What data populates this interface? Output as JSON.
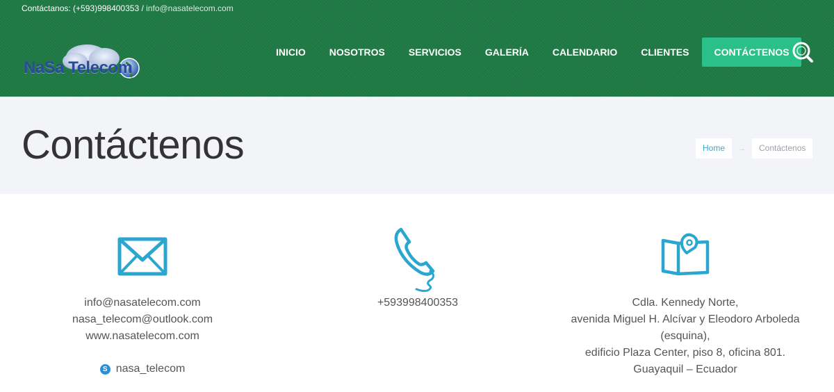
{
  "topbar": {
    "label": "Contáctanos: (+593)998400353 / ",
    "email": "info@nasatelecom.com"
  },
  "logo": {
    "text": "NaSa Telecom"
  },
  "nav": {
    "items": [
      {
        "label": "INICIO"
      },
      {
        "label": "NOSOTROS"
      },
      {
        "label": "SERVICIOS"
      },
      {
        "label": "GALERÍA"
      },
      {
        "label": "CALENDARIO"
      },
      {
        "label": "CLIENTES"
      },
      {
        "label": "CONTÁCTENOS",
        "active": true
      }
    ],
    "search_icon": "search-icon"
  },
  "page": {
    "title": "Contáctenos",
    "breadcrumb": {
      "home": "Home",
      "separator": "→",
      "current": "Contáctenos"
    }
  },
  "contact": {
    "email": {
      "icon": "envelope-icon",
      "lines": [
        "info@nasatelecom.com",
        "nasa_telecom@outlook.com",
        "www.nasatelecom.com"
      ],
      "skype": "nasa_telecom"
    },
    "phone": {
      "icon": "phone-icon",
      "lines": [
        "+593998400353"
      ]
    },
    "address": {
      "icon": "map-pin-icon",
      "lines": [
        "Cdla. Kennedy Norte,",
        "avenida Miguel H. Alcívar y Eleodoro Arboleda",
        "(esquina),",
        "edificio Plaza Center, piso 8, oficina 801.",
        "Guayaquil – Ecuador"
      ]
    }
  },
  "colors": {
    "header_green": "#1f7a45",
    "accent_teal": "#2bbf8a",
    "icon_blue": "#2aa6cf",
    "title_band": "#f2f4f7"
  }
}
